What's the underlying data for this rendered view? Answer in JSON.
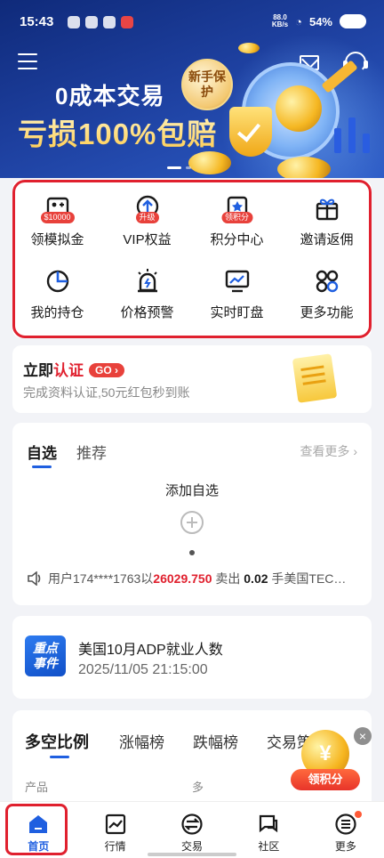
{
  "status_bar": {
    "time": "15:43",
    "speed_top": "88.0",
    "speed_unit": "KB/s",
    "battery": "54%"
  },
  "banner": {
    "title": "0成本交易",
    "subtitle": "亏损100%包赔",
    "badge": "新手保护"
  },
  "quick_menu": [
    {
      "label": "领模拟金",
      "tag": "$10000",
      "icon": "simulated-funds-icon"
    },
    {
      "label": "VIP权益",
      "tag": "升级",
      "icon": "vip-arrow-icon"
    },
    {
      "label": "积分中心",
      "tag": "领积分",
      "icon": "points-icon"
    },
    {
      "label": "邀请返佣",
      "tag": "",
      "icon": "gift-icon"
    },
    {
      "label": "我的持仓",
      "tag": "",
      "icon": "pie-chart-icon"
    },
    {
      "label": "价格预警",
      "tag": "",
      "icon": "alarm-icon"
    },
    {
      "label": "实时盯盘",
      "tag": "",
      "icon": "monitor-icon"
    },
    {
      "label": "更多功能",
      "tag": "",
      "icon": "grid-icon"
    }
  ],
  "auth": {
    "prefix": "立即",
    "highlight": "认证",
    "go": "GO",
    "desc": "完成资料认证,50元红包秒到账"
  },
  "watchlist": {
    "tabs": [
      "自选",
      "推荐"
    ],
    "see_more": "查看更多",
    "add_label": "添加自选",
    "ticker": {
      "prefix": "用户174****1763以",
      "price": "26029.750",
      "mid": "卖出",
      "qty": "0.02",
      "suffix": "手美国TEC…"
    }
  },
  "event": {
    "badge": "重点事件",
    "title": "美国10月ADP就业人数",
    "time": "2025/11/05 21:15:00"
  },
  "ratio": {
    "tabs": [
      "多空比例",
      "涨幅榜",
      "跌幅榜",
      "交易策略"
    ],
    "col_product": "产品",
    "col_long": "多"
  },
  "float_reward": {
    "label": "领积分",
    "symbol": "¥"
  },
  "bottom_nav": [
    {
      "label": "首页",
      "icon": "home-icon"
    },
    {
      "label": "行情",
      "icon": "market-chart-icon"
    },
    {
      "label": "交易",
      "icon": "trade-exchange-icon"
    },
    {
      "label": "社区",
      "icon": "community-chat-icon"
    },
    {
      "label": "更多",
      "icon": "more-menu-icon"
    }
  ],
  "colors": {
    "brand_blue": "#1f5fe0",
    "alert_red": "#e0202e"
  }
}
